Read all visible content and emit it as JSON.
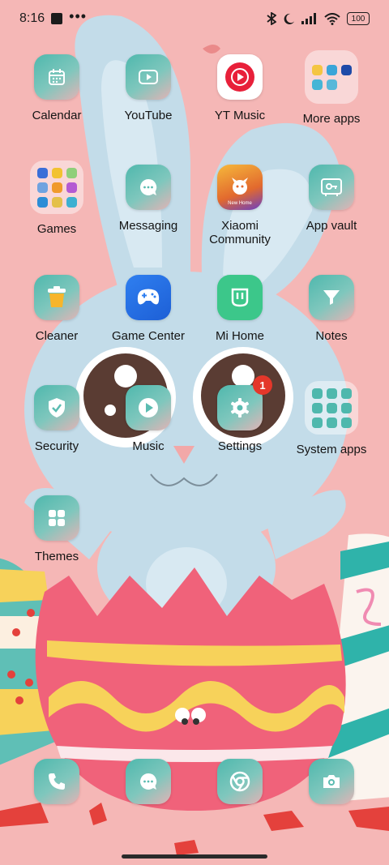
{
  "status_bar": {
    "time": "8:16",
    "battery": "100"
  },
  "apps": {
    "calendar": "Calendar",
    "youtube": "YouTube",
    "yt_music": "YT Music",
    "more_apps": "More apps",
    "games": "Games",
    "messaging": "Messaging",
    "xiaomi_community": "Xiaomi Community",
    "app_vault": "App vault",
    "cleaner": "Cleaner",
    "game_center": "Game Center",
    "mi_home": "Mi Home",
    "notes": "Notes",
    "security": "Security",
    "music": "Music",
    "settings": "Settings",
    "system_apps": "System apps",
    "themes": "Themes"
  },
  "badges": {
    "settings": "1"
  },
  "xiaomi_tile_text": "New Home",
  "colors": {
    "tile_teal": "#4fb8ad",
    "wallpaper_pink": "#f5b7b6",
    "bunny_blue": "#c3dce9",
    "badge_red": "#e4372a"
  }
}
